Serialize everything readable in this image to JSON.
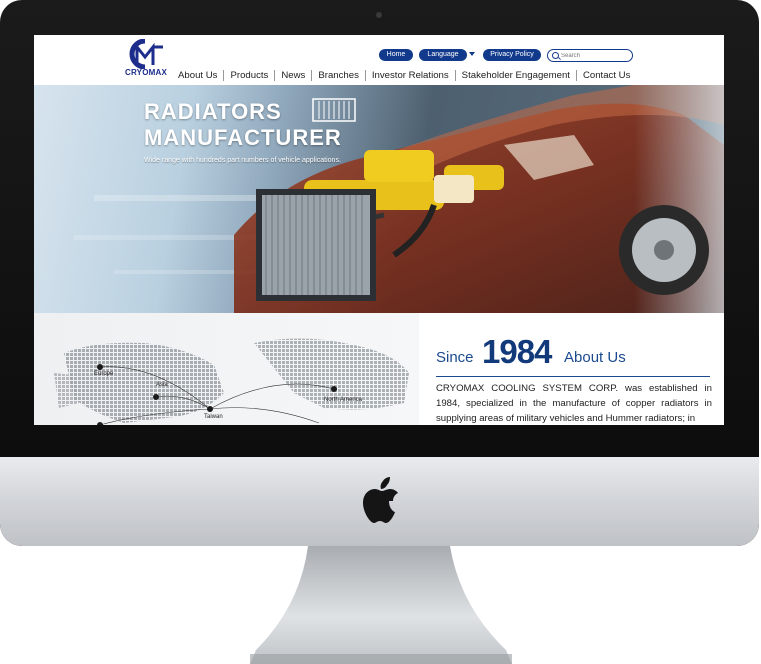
{
  "header": {
    "logo_text": "CRYOMAX",
    "top_links": {
      "home": "Home",
      "language": "Language",
      "privacy": "Privacy Policy"
    },
    "search": {
      "placeholder": "Search"
    },
    "nav": [
      "About Us",
      "Products",
      "News",
      "Branches",
      "Investor Relations",
      "Stakeholder Engagement",
      "Contact Us"
    ]
  },
  "hero": {
    "title_line1": "RADIATORS",
    "title_line2": "MANUFACTURER",
    "subtitle": "Wide range with hundreds part numbers of vehicle applications."
  },
  "map": {
    "labels": [
      "Europe",
      "Asia",
      "Taiwan",
      "North America"
    ]
  },
  "about": {
    "since": "Since",
    "year": "1984",
    "heading": "About Us",
    "text": "CRYOMAX COOLING SYSTEM CORP. was established in 1984, specialized in the manufacture of copper radiators in supplying areas of military vehicles and Hummer radiators; in"
  },
  "colors": {
    "brand_blue": "#123a8c",
    "dark_blue": "#123a7a",
    "bezel": "#111111",
    "chin": "#d6d9dc"
  },
  "icons": {
    "device_logo": "apple-icon",
    "search": "search-icon",
    "language_dropdown": "chevron-down-icon"
  }
}
